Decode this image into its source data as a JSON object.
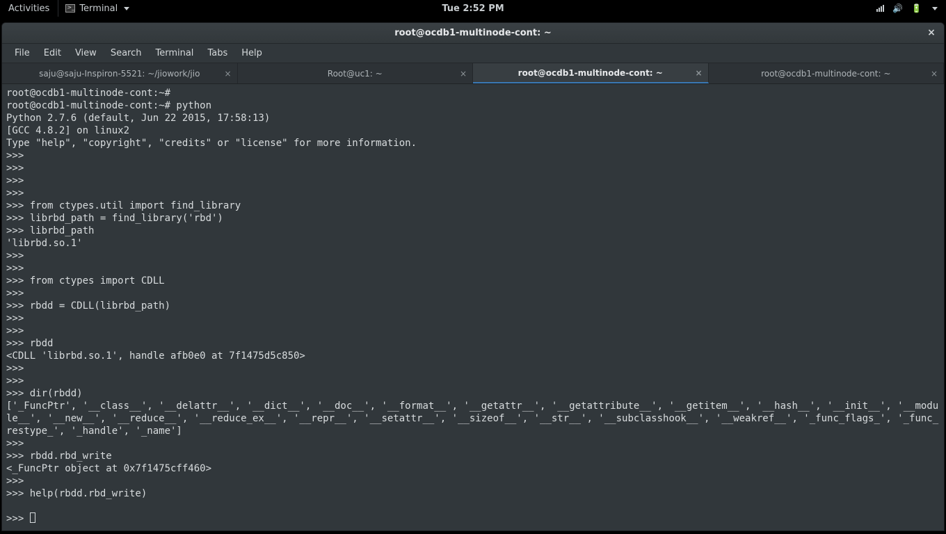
{
  "topbar": {
    "activities": "Activities",
    "app": "Terminal",
    "clock": "Tue  2:52 PM"
  },
  "window": {
    "title": "root@ocdb1-multinode-cont: ~"
  },
  "menu": {
    "file": "File",
    "edit": "Edit",
    "view": "View",
    "search": "Search",
    "terminal": "Terminal",
    "tabs": "Tabs",
    "help": "Help"
  },
  "tabs": [
    {
      "label": "saju@saju-Inspiron-5521: ~/jiowork/jio",
      "active": false,
      "closable": true
    },
    {
      "label": "Root@uc1: ~",
      "active": false,
      "closable": true
    },
    {
      "label": "root@ocdb1-multinode-cont: ~",
      "active": true,
      "closable": true
    },
    {
      "label": "root@ocdb1-multinode-cont: ~",
      "active": false,
      "closable": true
    }
  ],
  "terminal_lines": [
    "root@ocdb1-multinode-cont:~#",
    "root@ocdb1-multinode-cont:~# python",
    "Python 2.7.6 (default, Jun 22 2015, 17:58:13)",
    "[GCC 4.8.2] on linux2",
    "Type \"help\", \"copyright\", \"credits\" or \"license\" for more information.",
    ">>>",
    ">>>",
    ">>>",
    ">>>",
    ">>> from ctypes.util import find_library",
    ">>> librbd_path = find_library('rbd')",
    ">>> librbd_path",
    "'librbd.so.1'",
    ">>>",
    ">>>",
    ">>> from ctypes import CDLL",
    ">>>",
    ">>> rbdd = CDLL(librbd_path)",
    ">>>",
    ">>>",
    ">>> rbdd",
    "<CDLL 'librbd.so.1', handle afb0e0 at 7f1475d5c850>",
    ">>>",
    ">>>",
    ">>> dir(rbdd)",
    "['_FuncPtr', '__class__', '__delattr__', '__dict__', '__doc__', '__format__', '__getattr__', '__getattribute__', '__getitem__', '__hash__', '__init__', '__module__', '__new__', '__reduce__', '__reduce_ex__', '__repr__', '__setattr__', '__sizeof__', '__str__', '__subclasshook__', '__weakref__', '_func_flags_', '_func_restype_', '_handle', '_name']",
    ">>>",
    ">>> rbdd.rbd_write",
    "<_FuncPtr object at 0x7f1475cff460>",
    ">>>",
    ">>> help(rbdd.rbd_write)",
    "",
    ">>> "
  ]
}
